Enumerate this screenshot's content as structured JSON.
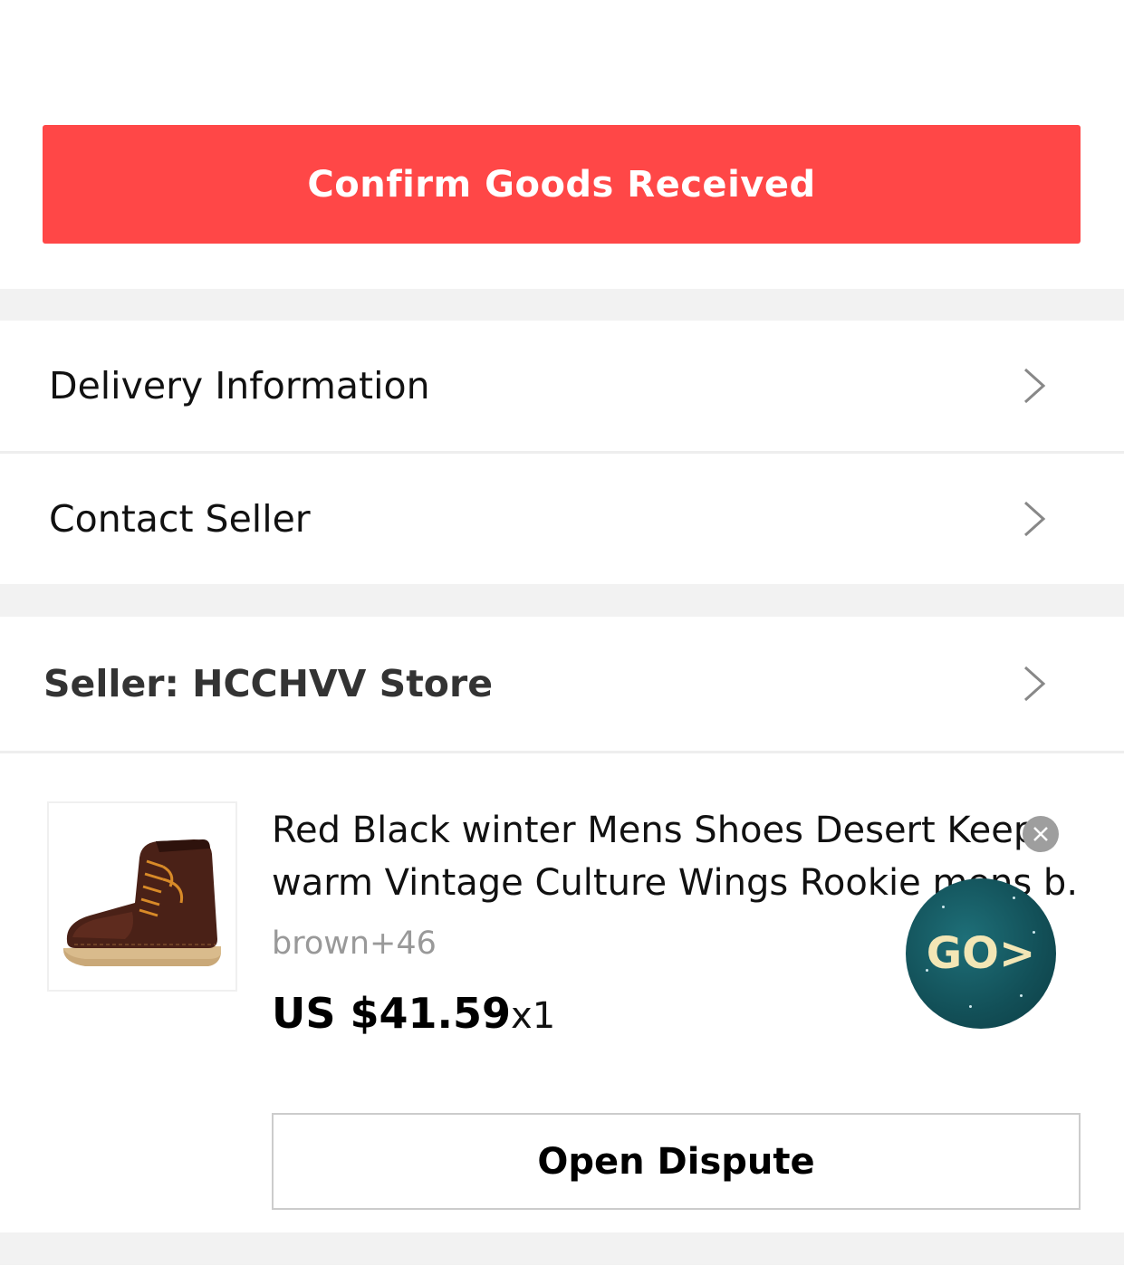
{
  "confirm_button": {
    "label": "Confirm Goods Received",
    "color": "#ff4747"
  },
  "menu": {
    "delivery_label": "Delivery Information",
    "contact_label": "Contact Seller"
  },
  "seller": {
    "label": "Seller: HCCHVV Store"
  },
  "product": {
    "title_line1": "Red Black winter Mens Shoes Desert Keep",
    "title_line2": "warm Vintage Culture Wings Rookie mens b...",
    "variant": "brown+46",
    "price": "US $41.59",
    "quantity": "x1",
    "image_icon": "brown-leather-boot"
  },
  "go_badge": {
    "label": "GO>"
  },
  "dispute_button": {
    "label": "Open Dispute"
  },
  "icons": {
    "chevron": "chevron-right-icon",
    "close": "close-icon"
  }
}
